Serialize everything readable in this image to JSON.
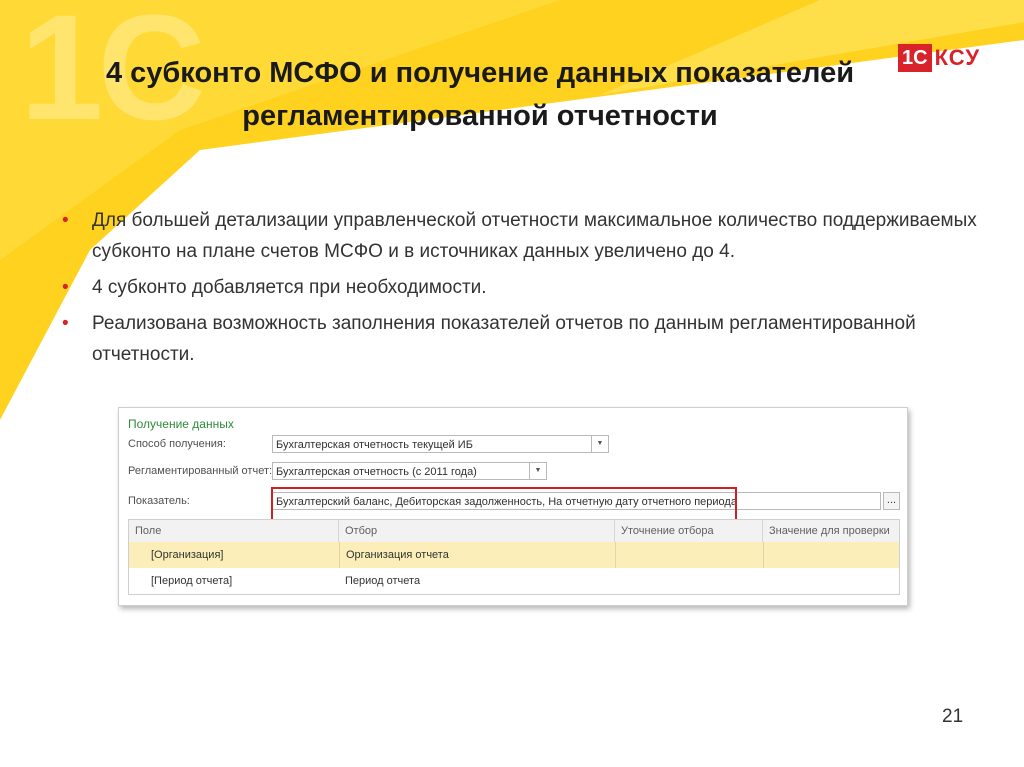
{
  "slide": {
    "title_line1": "4 субконто МСФО и получение данных показателей",
    "title_line2": "регламентированной  отчетности",
    "logo_watermark": "1C",
    "brand_1c": "1C",
    "brand_ksu": "КСУ",
    "page_number": "21",
    "accent_color": "#d8232a",
    "background_color": "#ffd21f"
  },
  "bullets": [
    {
      "marker": "•",
      "text": "Для большей детализации управленческой отчетности максимальное количество поддерживаемых субконто на плане счетов МСФО  и в источниках данных увеличено до 4."
    },
    {
      "marker": "•",
      "text": "4 субконто добавляется при необходимости."
    },
    {
      "marker": "•",
      "text": "Реализована возможность заполнения показателей отчетов по данным регламентированной отчетности."
    }
  ],
  "form": {
    "title": "Получение данных",
    "method_label": "Способ получения:",
    "method_value": "Бухгалтерская отчетность текущей ИБ",
    "report_label": "Регламентированный отчет:",
    "report_value": "Бухгалтерская отчетность (с 2011 года)",
    "indicator_label": "Показатель:",
    "indicator_value": "Бухгалтерский баланс, Дебиторская задолженность, На отчетную дату отчетного периода",
    "dots_button": "...",
    "dropdown_arrow": "▼",
    "table": {
      "columns": [
        "Поле",
        "Отбор",
        "Уточнение отбора",
        "Значение для проверки"
      ],
      "rows": [
        {
          "field": "[Организация]",
          "filter": "Организация отчета",
          "refine": "",
          "check": "",
          "selected": true
        },
        {
          "field": "[Период отчета]",
          "filter": "Период отчета",
          "refine": "",
          "check": "",
          "selected": false
        }
      ]
    }
  }
}
